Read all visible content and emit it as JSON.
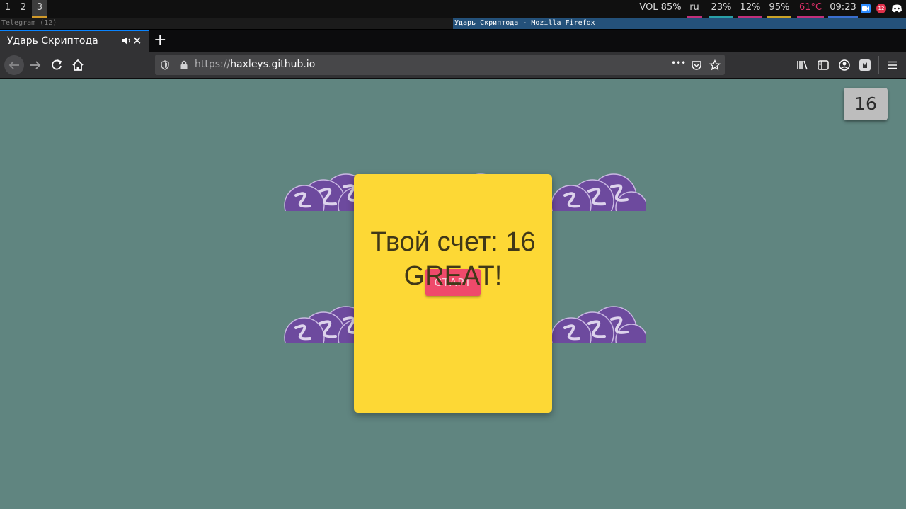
{
  "wm": {
    "workspaces": [
      "1",
      "2",
      "3"
    ],
    "active_workspace": "3",
    "stats": [
      {
        "label": "VOL 85%",
        "color": "#d8d8d8",
        "underline": ""
      },
      {
        "label": "ru",
        "color": "#d8d8d8",
        "underline": "#c0307a"
      },
      {
        "label": "23%",
        "color": "#d8d8d8",
        "underline": "#2aa0a8"
      },
      {
        "label": "12%",
        "color": "#d8d8d8",
        "underline": "#c0307a"
      },
      {
        "label": "95%",
        "color": "#d8d8d8",
        "underline": "#c9a227"
      },
      {
        "label": "61°C",
        "color": "#e0306a",
        "underline": "#c0307a"
      },
      {
        "label": "09:23",
        "color": "#d8d8d8",
        "underline": "#3a6fd0"
      }
    ],
    "tray_badge": "12"
  },
  "titles": {
    "telegram": "Telegram (12)",
    "firefox": "Ударь Скриптода - Mozilla Firefox"
  },
  "browser": {
    "tab_title": "Ударь Скриптода",
    "new_tab": "+",
    "close": "✕",
    "url_scheme": "https://",
    "url_host": "haxleys.github.io",
    "more": "•••"
  },
  "game": {
    "score": "16",
    "result_line1": "Твой счет: 16",
    "result_line2": "GREAT!",
    "start_label": "СТАРТ"
  },
  "colors": {
    "page_bg": "#608580",
    "modal_bg": "#fdd835",
    "start_bg": "#ef4a6b",
    "elixir_purple": "#6d4a9e"
  }
}
